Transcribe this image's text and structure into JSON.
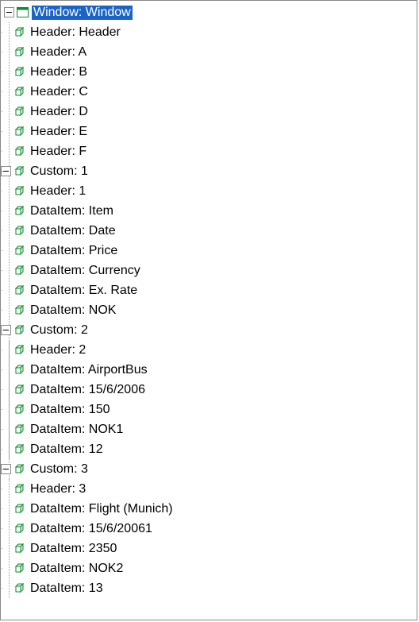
{
  "root": {
    "label": "Window: Window",
    "selected": true,
    "expanded": true,
    "icon": "window-icon"
  },
  "headers": [
    {
      "label": "Header: Header"
    },
    {
      "label": "Header: A"
    },
    {
      "label": "Header: B"
    },
    {
      "label": "Header: C"
    },
    {
      "label": "Header: D"
    },
    {
      "label": "Header: E"
    },
    {
      "label": "Header: F"
    }
  ],
  "groups": [
    {
      "label": "Custom: 1",
      "expanded": true,
      "items": [
        {
          "label": "Header: 1"
        },
        {
          "label": "DataItem: Item"
        },
        {
          "label": "DataItem: Date"
        },
        {
          "label": "DataItem: Price"
        },
        {
          "label": "DataItem: Currency"
        },
        {
          "label": "DataItem: Ex. Rate"
        },
        {
          "label": "DataItem: NOK"
        }
      ]
    },
    {
      "label": "Custom: 2",
      "expanded": true,
      "items": [
        {
          "label": "Header: 2"
        },
        {
          "label": "DataItem: AirportBus"
        },
        {
          "label": "DataItem: 15/6/2006"
        },
        {
          "label": "DataItem: 150"
        },
        {
          "label": "DataItem: NOK1"
        },
        {
          "label": "DataItem: 12"
        }
      ]
    },
    {
      "label": "Custom: 3",
      "expanded": true,
      "items": [
        {
          "label": "Header: 3"
        },
        {
          "label": "DataItem: Flight (Munich)"
        },
        {
          "label": "DataItem: 15/6/20061"
        },
        {
          "label": "DataItem: 2350"
        },
        {
          "label": "DataItem: NOK2"
        },
        {
          "label": "DataItem: 13"
        }
      ]
    }
  ]
}
